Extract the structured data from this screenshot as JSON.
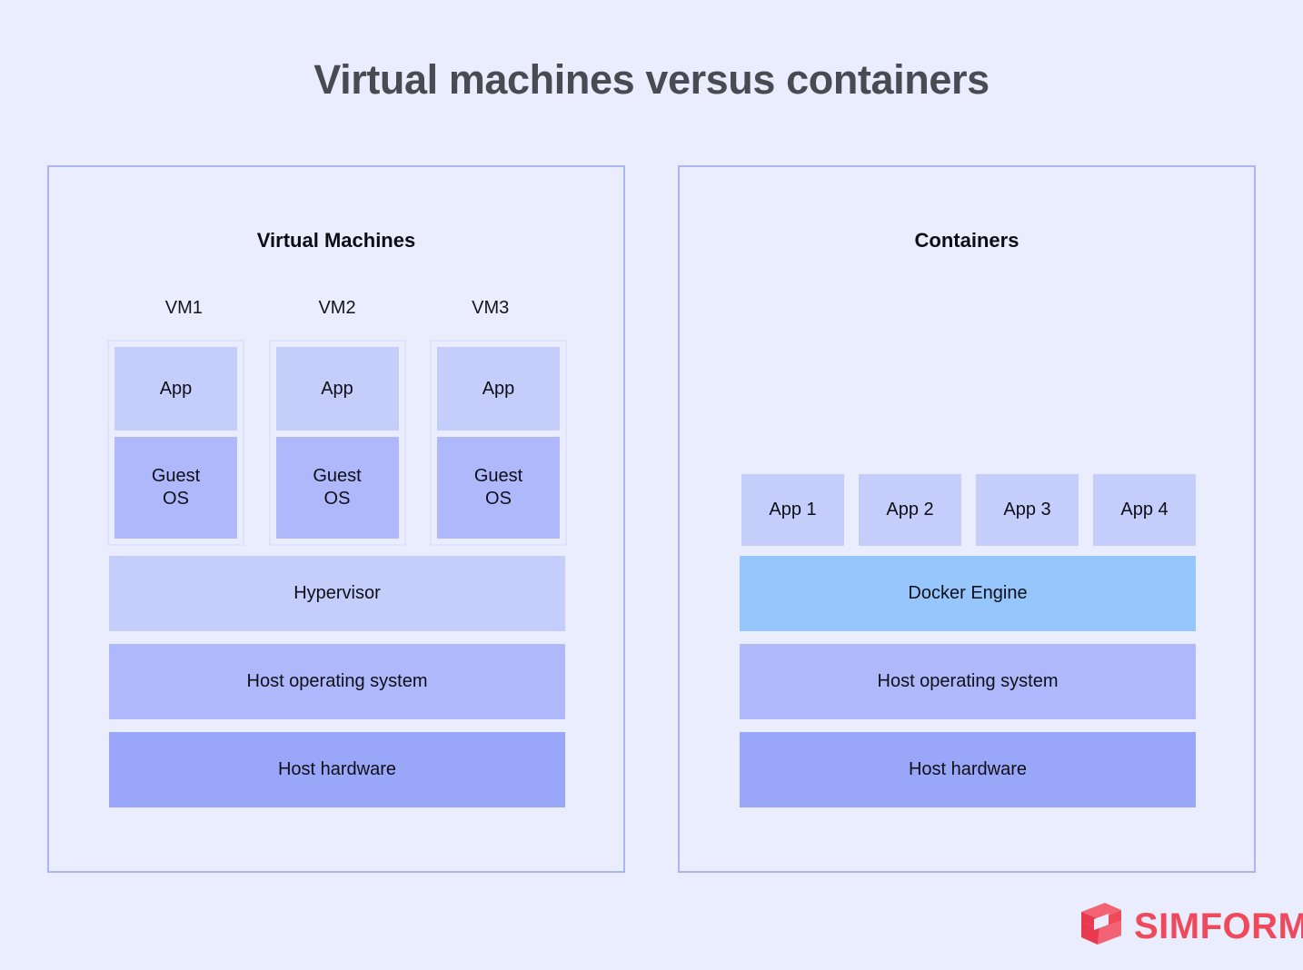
{
  "page": {
    "title": "Virtual machines versus containers",
    "background_color": "#e9edfd"
  },
  "colors": {
    "panel_border": "#aab6ee",
    "app_box": "#c5cdfb",
    "guest_os_box": "#aeb8fb",
    "hypervisor_bar": "#c5cdfb",
    "docker_engine_bar": "#97c6fd",
    "host_os_bar": "#aeb8fb",
    "host_hardware_bar": "#9aa7f9",
    "title_text": "#4a4a52",
    "brand_red": "#ee4a5c"
  },
  "vm_panel": {
    "heading": "Virtual Machines",
    "vms": [
      {
        "label": "VM1",
        "app": "App",
        "guest_os": "Guest\nOS"
      },
      {
        "label": "VM2",
        "app": "App",
        "guest_os": "Guest\nOS"
      },
      {
        "label": "VM3",
        "app": "App",
        "guest_os": "Guest\nOS"
      }
    ],
    "stack": [
      {
        "label": "Hypervisor"
      },
      {
        "label": "Host operating system"
      },
      {
        "label": "Host hardware"
      }
    ]
  },
  "container_panel": {
    "heading": "Containers",
    "apps": [
      {
        "label": "App 1"
      },
      {
        "label": "App 2"
      },
      {
        "label": "App 3"
      },
      {
        "label": "App 4"
      }
    ],
    "stack": [
      {
        "label": "Docker Engine"
      },
      {
        "label": "Host operating system"
      },
      {
        "label": "Host hardware"
      }
    ]
  },
  "logo": {
    "text": "SIMFORM",
    "mark": "simform-logo-icon"
  }
}
